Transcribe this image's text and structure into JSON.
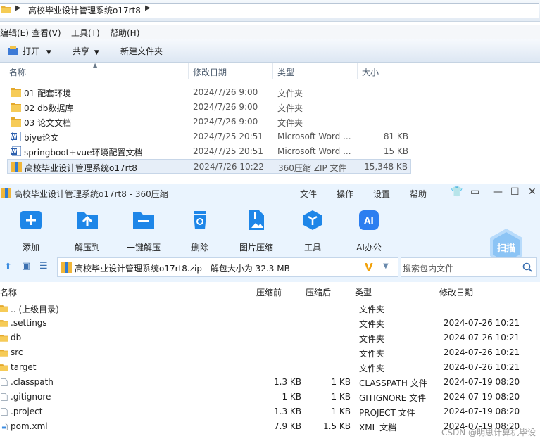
{
  "explorer": {
    "address": {
      "path": "高校毕业设计管理系统o17rt8"
    },
    "menu": [
      "编辑(E)",
      "查看(V)",
      "工具(T)",
      "帮助(H)"
    ],
    "toolbar": {
      "open": "打开",
      "share": "共享",
      "new_folder": "新建文件夹"
    },
    "columns": {
      "name": "名称",
      "date": "修改日期",
      "type": "类型",
      "size": "大小"
    },
    "files": [
      {
        "name": "01 配套环境",
        "date": "2024/7/26 9:00",
        "type": "文件夹",
        "size": "",
        "icon": "folder-icon"
      },
      {
        "name": "02 db数据库",
        "date": "2024/7/26 9:00",
        "type": "文件夹",
        "size": "",
        "icon": "folder-icon"
      },
      {
        "name": "03 论文文档",
        "date": "2024/7/26 9:00",
        "type": "文件夹",
        "size": "",
        "icon": "folder-icon"
      },
      {
        "name": "biye论文",
        "date": "2024/7/25 20:51",
        "type": "Microsoft Word ...",
        "size": "81 KB",
        "icon": "word-doc-icon"
      },
      {
        "name": "springboot+vue环境配置文档",
        "date": "2024/7/25 20:51",
        "type": "Microsoft Word ...",
        "size": "15 KB",
        "icon": "word-doc-icon"
      },
      {
        "name": "高校毕业设计管理系统o17rt8",
        "date": "2024/7/26 10:22",
        "type": "360压缩 ZIP 文件",
        "size": "15,348 KB",
        "icon": "zip-archive-icon"
      }
    ]
  },
  "zip": {
    "title": "高校毕业设计管理系统o17rt8 - 360压缩",
    "menu": {
      "file": "文件",
      "action": "操作",
      "settings": "设置",
      "help": "帮助"
    },
    "tools": [
      "添加",
      "解压到",
      "一键解压",
      "删除",
      "图片压缩",
      "工具",
      "AI办公"
    ],
    "scan_label": "扫描",
    "path": "高校毕业设计管理系统o17rt8.zip - 解包大小为 32.3 MB",
    "search_placeholder": "搜索包内文件",
    "columns": {
      "name": "名称",
      "compressed": "压缩前",
      "packed": "压缩后",
      "type": "类型",
      "date": "修改日期"
    },
    "entries": [
      {
        "name": ".. (上级目录)",
        "before": "",
        "after": "",
        "type": "文件夹",
        "date": "",
        "icon": "folder-icon"
      },
      {
        "name": ".settings",
        "before": "",
        "after": "",
        "type": "文件夹",
        "date": "2024-07-26 10:21",
        "icon": "folder-icon"
      },
      {
        "name": "db",
        "before": "",
        "after": "",
        "type": "文件夹",
        "date": "2024-07-26 10:21",
        "icon": "folder-icon"
      },
      {
        "name": "src",
        "before": "",
        "after": "",
        "type": "文件夹",
        "date": "2024-07-26 10:21",
        "icon": "folder-icon"
      },
      {
        "name": "target",
        "before": "",
        "after": "",
        "type": "文件夹",
        "date": "2024-07-26 10:21",
        "icon": "folder-icon"
      },
      {
        "name": ".classpath",
        "before": "1.3 KB",
        "after": "1 KB",
        "type": "CLASSPATH 文件",
        "date": "2024-07-19 08:20",
        "icon": "file-icon"
      },
      {
        "name": ".gitignore",
        "before": "1 KB",
        "after": "1 KB",
        "type": "GITIGNORE 文件",
        "date": "2024-07-19 08:20",
        "icon": "file-icon"
      },
      {
        "name": ".project",
        "before": "1.3 KB",
        "after": "1 KB",
        "type": "PROJECT 文件",
        "date": "2024-07-19 08:20",
        "icon": "file-icon"
      },
      {
        "name": "pom.xml",
        "before": "7.9 KB",
        "after": "1.5 KB",
        "type": "XML 文档",
        "date": "2024-07-19 08:20",
        "icon": "xml-file-icon"
      }
    ],
    "watermark": "CSDN @明思计算机毕设"
  }
}
